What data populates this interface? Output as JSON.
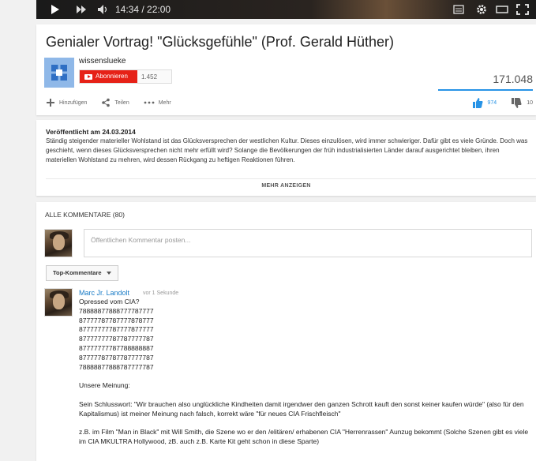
{
  "player": {
    "time": "14:34 / 22:00"
  },
  "video": {
    "title": "Genialer Vortrag! \"Glücksgefühle\" (Prof. Gerald Hüther)",
    "views": "171.048"
  },
  "channel": {
    "name": "wissenslueke",
    "subscribe_label": "Abonnieren",
    "subscriber_count": "1.452"
  },
  "actions": {
    "add": "Hinzufügen",
    "share": "Teilen",
    "more": "Mehr",
    "likes": "974",
    "dislikes": "10"
  },
  "description": {
    "published": "Veröffentlicht am 24.03.2014",
    "text": "Ständig steigender materieller Wohlstand ist das Glücksversprechen der westlichen Kultur. Dieses einzulösen, wird immer schwieriger. Dafür gibt es viele Gründe. Doch was geschieht, wenn dieses Glücksversprechen nicht mehr erfüllt wird? Solange die Bevölkerungen der früh industrialisierten Länder darauf ausgerichtet bleiben, ihren materiellen Wohlstand zu mehren, wird dessen Rückgang zu heftigen Reaktionen führen.",
    "show_more": "MEHR ANZEIGEN"
  },
  "comments": {
    "header": "ALLE KOMMENTARE (80)",
    "placeholder": "Öffentlichen Kommentar posten...",
    "sort_label": "Top-Kommentare",
    "items": [
      {
        "author": "Marc Jr. Landolt",
        "time": "vor 1 Sekunde",
        "lines": [
          "Opressed vom CIA?",
          "78888877888777787777",
          "87777787787777878777",
          "87777777787777877777",
          "87777777787787777787",
          "87777777787788888887",
          "87777787787787777787",
          "78888877888787777787",
          "",
          "Unsere Meinung:",
          "",
          "Sein Schlusswort: \"Wir brauchen also unglückliche Kindheiten damit irgendwer den ganzen Schrott kauft den sonst keiner kaufen würde\" (also für den Kapitalismus) ist meiner Meinung nach falsch, korrekt wäre \"für neues CIA Frischfleisch\"",
          "",
          "z.B. im Film \"Man in Black\" mit Will Smith, die Szene wo er den /elitären/ erhabenen CIA \"Herrenrassen\" Aunzug bekommt (Solche Szenen gibt es viele im CIA MKULTRA Hollywood, zB. auch z.B. Karte Kit geht schon in diese Sparte)"
        ]
      }
    ]
  }
}
